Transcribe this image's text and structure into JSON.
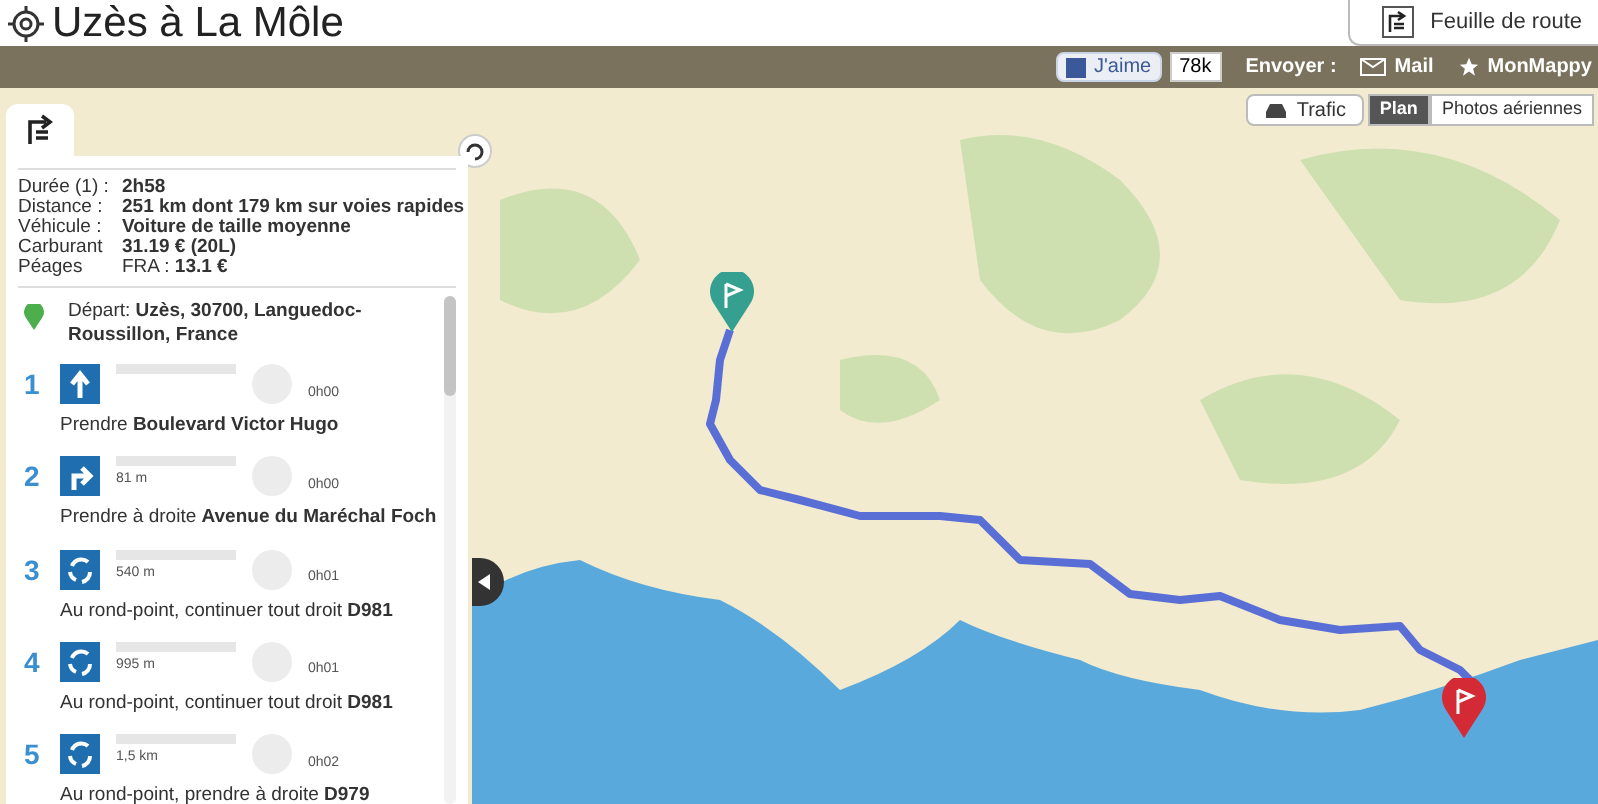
{
  "header": {
    "title": "Uzès à La Môle",
    "roadsheet_tab": "Feuille de route"
  },
  "share_bar": {
    "like_button": "J'aime",
    "like_count": "78k",
    "send_label": "Envoyer :",
    "mail_link": "Mail",
    "mappy_link": "MonMappy"
  },
  "map_controls": {
    "traffic_button": "Trafic",
    "view_tabs": [
      {
        "label": "Plan",
        "selected": true
      },
      {
        "label": "Photos aériennes",
        "selected": false
      }
    ]
  },
  "summary": [
    {
      "label": "Durée (1) :",
      "value": "**2h58**"
    },
    {
      "label": "Distance :",
      "value": "**251 km dont 179 km sur voies rapides**"
    },
    {
      "label": "Véhicule :",
      "value": "**Voiture de taille moyenne**"
    },
    {
      "label": "Carburant",
      "value": "**31.19 € (20L)**"
    },
    {
      "label": "Péages",
      "value": "FRA : **13.1 €**"
    }
  ],
  "departure": "Départ: **Uzès, 30700, Languedoc-Roussillon, France**",
  "steps": [
    {
      "number": "1",
      "kind": "straight",
      "time": "0h00",
      "instruction": "Prendre **Boulevard Victor Hugo**"
    },
    {
      "number": "2",
      "kind": "right",
      "distance": "81 m",
      "time": "0h00",
      "instruction": "Prendre à droite **Avenue du Maréchal Foch**"
    },
    {
      "number": "3",
      "kind": "roundabout",
      "distance": "540 m",
      "time": "0h01",
      "instruction": "Au rond-point, continuer tout droit **D981**"
    },
    {
      "number": "4",
      "kind": "roundabout",
      "distance": "995 m",
      "time": "0h01",
      "instruction": "Au rond-point, continuer tout droit **D981**"
    },
    {
      "number": "5",
      "kind": "roundabout",
      "distance": "1,5 km",
      "time": "0h02",
      "instruction": "Au rond-point, prendre à droite **D979**"
    }
  ]
}
